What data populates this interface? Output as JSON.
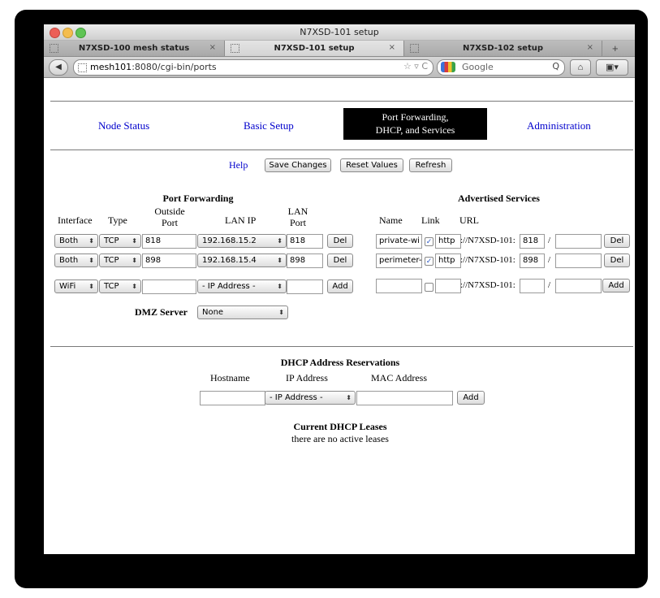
{
  "browser": {
    "window_title": "N7XSD-101 setup",
    "tabs": [
      {
        "label": "N7XSD-100 mesh status",
        "close": "×"
      },
      {
        "label": "N7XSD-101 setup",
        "close": "×"
      },
      {
        "label": "N7XSD-102 setup",
        "close": "×"
      }
    ],
    "new_tab": "+",
    "url_host": "mesh101",
    "url_rest": ":8080/cgi-bin/ports",
    "url_icons": "☆ ▿ C",
    "search_placeholder": "Google",
    "back_glyph": "◀",
    "home_glyph": "⌂",
    "ext_glyph": "▣▾",
    "search_glyph": "Q"
  },
  "nav": {
    "node_status": "Node Status",
    "basic_setup": "Basic Setup",
    "port_forwarding_line1": "Port Forwarding,",
    "port_forwarding_line2": "DHCP, and Services",
    "administration": "Administration"
  },
  "actions": {
    "help": "Help",
    "save": "Save Changes",
    "reset": "Reset Values",
    "refresh": "Refresh"
  },
  "port_forwarding": {
    "title": "Port Forwarding",
    "headers": {
      "interface": "Interface",
      "type": "Type",
      "outside_port_1": "Outside",
      "outside_port_2": "Port",
      "lan_ip": "LAN IP",
      "lan_port_1": "LAN",
      "lan_port_2": "Port"
    },
    "rows": [
      {
        "interface": "Both",
        "type": "TCP",
        "outside_port": "818",
        "lan_ip": "192.168.15.2",
        "lan_port": "818",
        "action": "Del"
      },
      {
        "interface": "Both",
        "type": "TCP",
        "outside_port": "898",
        "lan_ip": "192.168.15.4",
        "lan_port": "898",
        "action": "Del"
      }
    ],
    "new_row": {
      "interface": "WiFi",
      "type": "TCP",
      "outside_port": "",
      "lan_ip": "- IP Address -",
      "lan_port": "",
      "action": "Add"
    },
    "dmz_label": "DMZ Server",
    "dmz_value": "None"
  },
  "services": {
    "title": "Advertised Services",
    "headers": {
      "name": "Name",
      "link": "Link",
      "url": "URL"
    },
    "rows": [
      {
        "name": "private-wi",
        "link": true,
        "proto": "http",
        "host": "://N7XSD-101:",
        "port": "818",
        "slash": "/",
        "path": "",
        "action": "Del"
      },
      {
        "name": "perimeter-",
        "link": true,
        "proto": "http",
        "host": "://N7XSD-101:",
        "port": "898",
        "slash": "/",
        "path": "",
        "action": "Del"
      }
    ],
    "new_row": {
      "name": "",
      "link": false,
      "proto": "",
      "host": "://N7XSD-101:",
      "port": "",
      "slash": "/",
      "path": "",
      "action": "Add"
    }
  },
  "dhcp": {
    "title": "DHCP Address Reservations",
    "headers": {
      "hostname": "Hostname",
      "ip": "IP Address",
      "mac": "MAC Address"
    },
    "new_row": {
      "hostname": "",
      "ip": "- IP Address -",
      "mac": "",
      "action": "Add"
    },
    "leases_title": "Current DHCP Leases",
    "leases_text": "there are no active leases"
  },
  "glyphs": {
    "select_arrow": "⬍",
    "check": "✓"
  },
  "colors": {
    "link": "#0000cc",
    "active_tab_bg": "#000000",
    "active_tab_fg": "#ffffff"
  }
}
